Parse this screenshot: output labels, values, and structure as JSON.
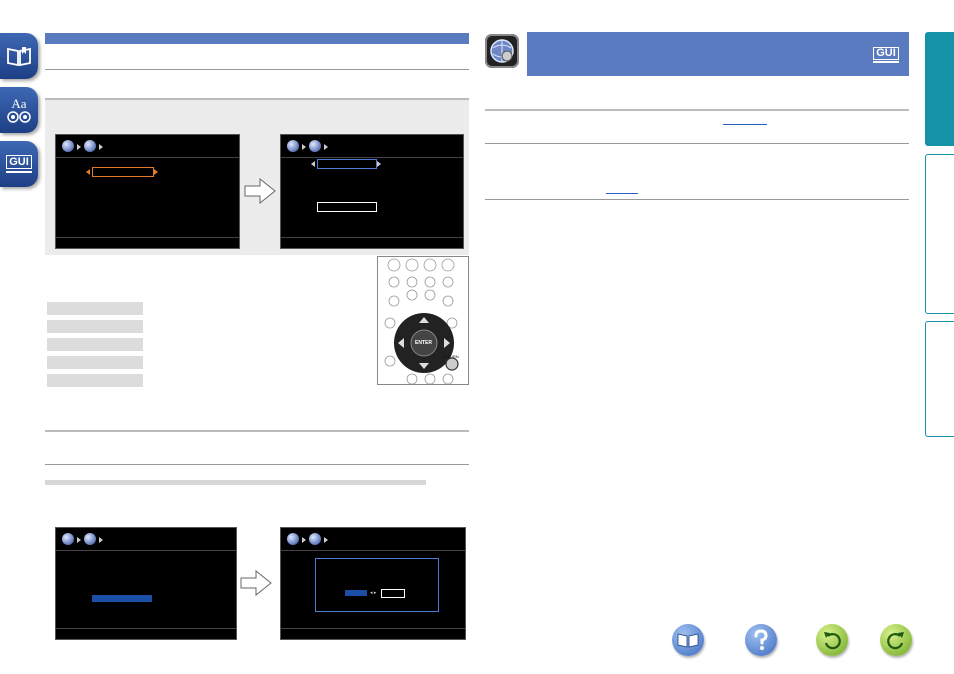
{
  "side_tabs": [
    {
      "name": "contents-tab"
    },
    {
      "name": "glossary-tab",
      "label": "Aa"
    },
    {
      "name": "gui-tab",
      "label": "GUI"
    }
  ],
  "header_badge": {
    "label": "GUI"
  },
  "screen_diagrams": {
    "enter_label": "ENTER",
    "return_label": "RETURN"
  },
  "colors": {
    "accent_blue": "#5b7bc0",
    "tab_teal": "#1591a8",
    "bar_blue": "#1b4fa6"
  }
}
